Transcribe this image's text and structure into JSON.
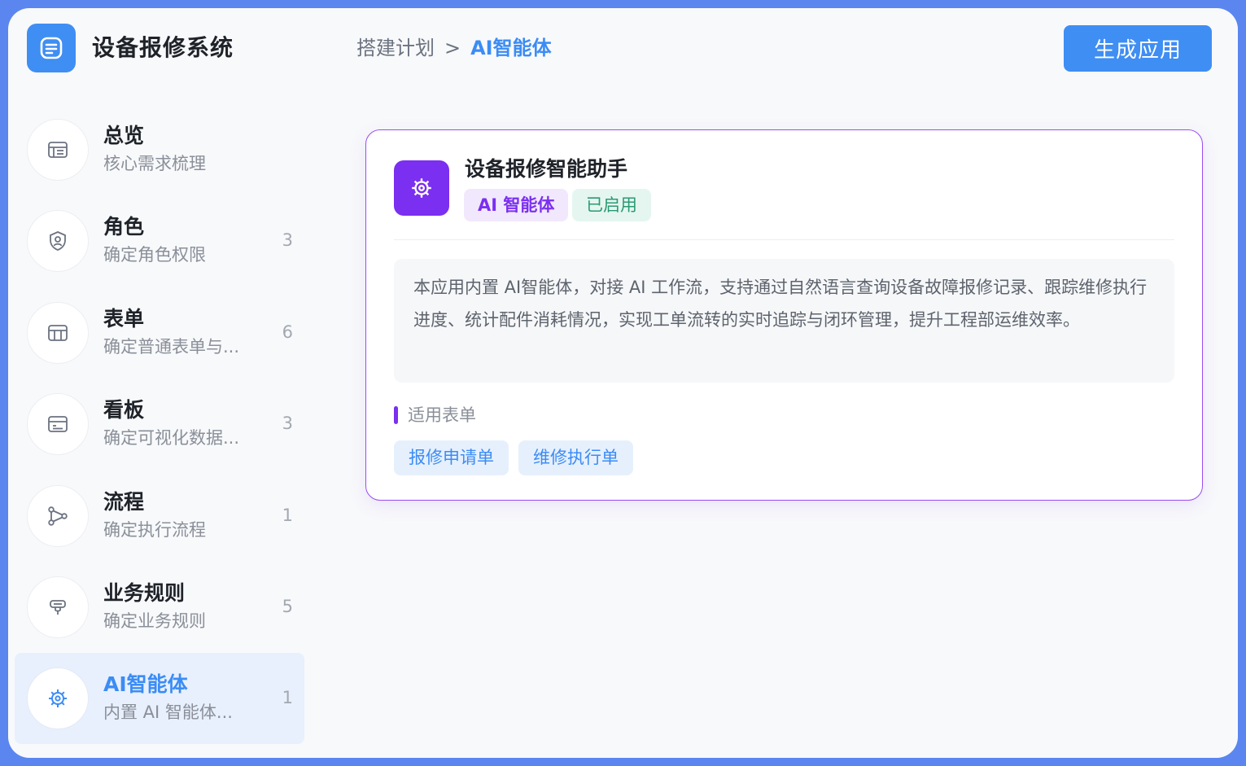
{
  "app": {
    "title": "设备报修系统",
    "logo_icon": "document-list-icon"
  },
  "breadcrumb": {
    "parent": "搭建计划",
    "separator": ">",
    "current": "AI智能体"
  },
  "header": {
    "generate_label": "生成应用"
  },
  "sidebar": {
    "items": [
      {
        "name": "总览",
        "sub": "核心需求梳理",
        "count": "",
        "icon": "overview-icon"
      },
      {
        "name": "角色",
        "sub": "确定角色权限",
        "count": "3",
        "icon": "shield-user-icon"
      },
      {
        "name": "表单",
        "sub": "确定普通表单与...",
        "count": "6",
        "icon": "table-icon"
      },
      {
        "name": "看板",
        "sub": "确定可视化数据...",
        "count": "3",
        "icon": "dashboard-icon"
      },
      {
        "name": "流程",
        "sub": "确定执行流程",
        "count": "1",
        "icon": "flow-icon"
      },
      {
        "name": "业务规则",
        "sub": "确定业务规则",
        "count": "5",
        "icon": "rule-icon"
      },
      {
        "name": "AI智能体",
        "sub": "内置 AI 智能体...",
        "count": "1",
        "icon": "ai-gear-icon",
        "active": true
      }
    ]
  },
  "agent": {
    "name": "设备报修智能助手",
    "tag_type": "AI 智能体",
    "tag_status": "已启用",
    "description": "本应用内置 AI智能体，对接 AI 工作流，支持通过自然语言查询设备故障报修记录、跟踪维修执行进度、统计配件消耗情况，实现工单流转的实时追踪与闭环管理，提升工程部运维效率。",
    "forms_title": "适用表单",
    "forms": [
      "报修申请单",
      "维修执行单"
    ]
  },
  "colors": {
    "primary": "#3f8ef3",
    "purple": "#7b2ff0",
    "green": "#2a9a72",
    "frame": "#5b86f0"
  }
}
